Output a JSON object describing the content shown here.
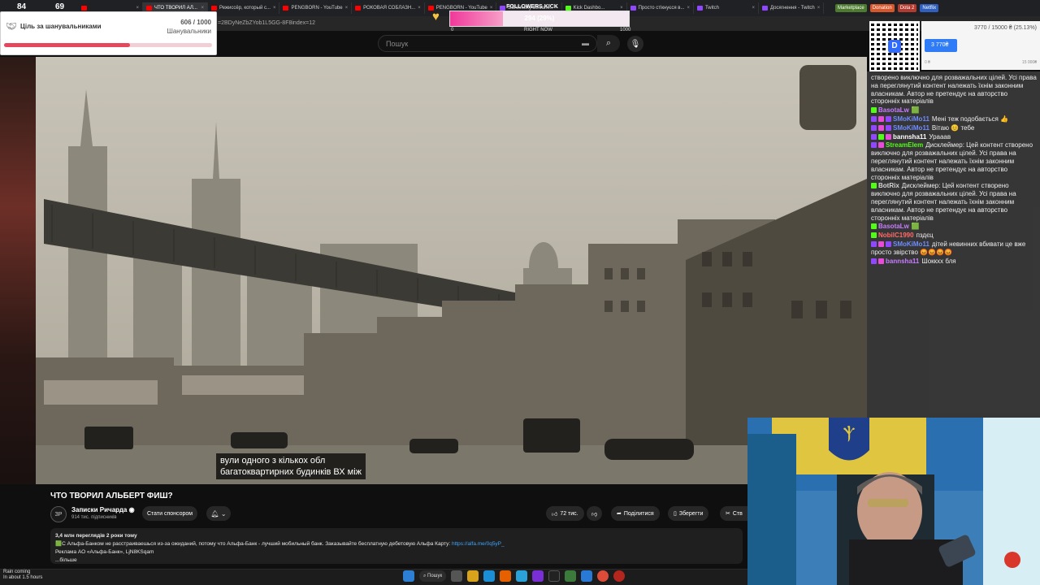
{
  "browser": {
    "tabs": [
      {
        "label": "",
        "type": "yt",
        "active": false
      },
      {
        "label": "ЧТО ТВОРИЛ АЛ...",
        "type": "yt",
        "active": true
      },
      {
        "label": "Режиссёр, который с...",
        "type": "yt",
        "active": false
      },
      {
        "label": "PENGBORN - YouTube",
        "type": "yt",
        "active": false
      },
      {
        "label": "РОКОВАЯ СОБЛАЗН...",
        "type": "yt",
        "active": false
      },
      {
        "label": "PENGBORN - YouTube",
        "type": "yt",
        "active": false
      },
      {
        "label": "BS/eimeky Stream...",
        "type": "tw",
        "active": false
      },
      {
        "label": "Kick Dashbo...",
        "type": "kk",
        "active": false
      },
      {
        "label": "Просто стікнуєся в...",
        "type": "tw",
        "active": false
      },
      {
        "label": "Twitch",
        "type": "tw",
        "active": false
      },
      {
        "label": "Досягнення - Twitch",
        "type": "tw",
        "active": false
      }
    ],
    "bookmarks": [
      {
        "label": "Marketplace",
        "color": "#4c7a2e"
      },
      {
        "label": "Donation",
        "color": "#d8562b"
      },
      {
        "label": "Dota 2",
        "color": "#b23a2f"
      },
      {
        "label": "Netflix",
        "color": "#2f5fbf"
      }
    ],
    "url": "=2BDyNeZbZYob1L5GG-8F8index=12"
  },
  "youtube": {
    "search_placeholder": "Пошук",
    "caption": "вули одного з кількох обл\nбагатоквартирних будинків ВХ між",
    "video_title": "ЧТО ТВОРИЛ АЛЬБЕРТ ФИШ?",
    "channel_name": "Записки Ричарда ◉",
    "channel_avatar": "ЗР",
    "subscribers": "914 тис. підписників",
    "sponsor_label": "Стати спонсором",
    "likes": "72 тис.",
    "share_label": "Поділитися",
    "save_label": "Зберегти",
    "more_label": "Ств",
    "desc_meta": "3,4 млн переглядів  2 роки тому",
    "desc_line1": "🟩С Альфа-Банком не расстраиваешься из-за ожиданий, потому что Альфа-Банк - лучший мобильный банк. Заказывайте бесплатную дебетовую Альфа Карту: ",
    "desc_link": "https://alfa.me/0q5yP_",
    "desc_line2": "Реклама АО «Альфа-Банк», LjN8KSqam",
    "desc_more": "...більше"
  },
  "stream": {
    "counter_viewers": "84",
    "counter_kick": "69",
    "goal_title": "Ціль за шанувальниками",
    "goal_count": "606 / 1000",
    "goal_unit": "Шанувальники",
    "goal_progress": 0.606,
    "followers_title": "FOLLOWERS KICK",
    "followers_value": "294 (29%)",
    "followers_progress": 0.294,
    "followers_min": "0",
    "followers_max": "1000",
    "followers_now": "RIGHT NOW",
    "donation_text": "3770 / 15000 ₴ (25.13%)",
    "donation_fill_label": "3 770₴",
    "donation_progress": 0.2513,
    "donation_min": "0 ₴",
    "donation_max": "15 000₴",
    "qr_logo": "D"
  },
  "chat": [
    {
      "user": "",
      "text": "створено виключно для розважальних цілей. Усі права на переглянутий контент належать їхнім законним власникам. Автор не претендує на авторство сторонніх матеріалів",
      "badges": [],
      "color": "#ffffff"
    },
    {
      "user": "BasotaLw",
      "text": "🟩",
      "badges": [
        "kick"
      ],
      "color": "#c77dff"
    },
    {
      "user": "SMoKiMo11",
      "text": "Мені теж подобається 👍",
      "badges": [
        "tw",
        "pk",
        "tw"
      ],
      "color": "#6f8cff"
    },
    {
      "user": "SMoKiMo11",
      "text": "Вітаю 😊 тебе",
      "badges": [
        "tw",
        "pk",
        "tw"
      ],
      "color": "#6f8cff"
    },
    {
      "user": "bannsha11",
      "text": "Урааав",
      "badges": [
        "tw",
        "kick",
        "pk"
      ],
      "color": "#ffffff"
    },
    {
      "user": "StreamElem",
      "text": "Дисклеймер: Цей контент створено виключно для розважальних цілей. Усі права на переглянутий контент належать їхнім законним власникам. Автор не претендує на авторство сторонніх матеріалів",
      "badges": [
        "tw",
        "pk"
      ],
      "color": "#53fc18"
    },
    {
      "user": "BotRix",
      "text": "Дисклеймер: Цей контент створено виключно для розважальних цілей. Усі права на переглянутий контент належать їхнім законним власникам. Автор не претендує на авторство сторонніх матеріалів",
      "badges": [
        "kick"
      ],
      "color": "#d7d7d7"
    },
    {
      "user": "BasotaLw",
      "text": "🟩",
      "badges": [
        "kick"
      ],
      "color": "#c77dff"
    },
    {
      "user": "NobilC1990",
      "text": "пздєц",
      "badges": [
        "kick"
      ],
      "color": "#ff6b6b"
    },
    {
      "user": "SMoKiMo11",
      "text": "дітей невинних вбивати це вже просто звірство 😡😡😡😡",
      "badges": [
        "tw",
        "pk",
        "tw"
      ],
      "color": "#6f8cff"
    },
    {
      "user": "bannsha11",
      "text": "Шоккхх бля",
      "badges": [
        "tw",
        "pk"
      ],
      "color": "#c77dff"
    }
  ],
  "taskbar": {
    "weather_title": "Rain coming",
    "weather_sub": "In about 1.5 hours",
    "search_label": "Пошук"
  }
}
